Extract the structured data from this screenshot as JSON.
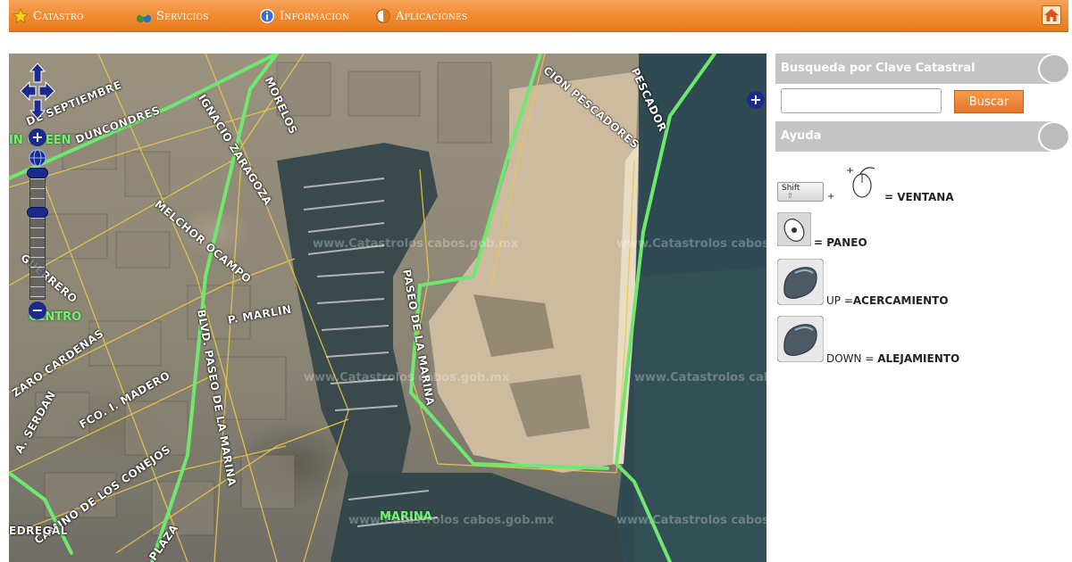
{
  "nav": {
    "items": [
      {
        "label": "Catastro",
        "icon": "star-icon"
      },
      {
        "label": "Servicios",
        "icon": "services-icon"
      },
      {
        "label": "Informacion",
        "icon": "info-icon"
      },
      {
        "label": "Aplicaciones",
        "icon": "apps-icon"
      }
    ],
    "home_icon": "home-icon",
    "bar_color": "#ef8a2f"
  },
  "map": {
    "streets": [
      "DE SEPTIEMBRE",
      "DUNCONDRES",
      "IGNACIO ZARAGOZA",
      "MORELOS",
      "MELCHOR OCAMPO",
      "GUERRERO",
      "P. MARLIN",
      "BLVD. PASEO DE LA MARINA",
      "PASEO DE LA MARINA",
      "ZARO CARDENAS",
      "FCO. I. MADERO",
      "A. SERDAN",
      "CAMINO DE LOS CONEJOS",
      "PLAZA",
      "CION PESCADORES",
      "PESCADOR",
      "EDREGAL"
    ],
    "zones": [
      "IN GREEN",
      "CENTRO",
      "MARINA"
    ],
    "watermark": "www.Catastrolos cabos.gob.mx",
    "boundary_color": "#6ee86e",
    "controls": {
      "zoom_in": "+",
      "zoom_out": "−",
      "layer_switcher": "+"
    }
  },
  "panel": {
    "busqueda": {
      "title": "Busqueda por Clave Catastral",
      "input_value": "",
      "input_placeholder": "",
      "button_label": "Buscar"
    },
    "ayuda": {
      "title": "Ayuda",
      "items": [
        {
          "key_label": "Shift",
          "plus": "+",
          "eq": "= VENTANA"
        },
        {
          "eq": "= PANEO"
        },
        {
          "prefix": "UP =",
          "bold": "ACERCAMIENTO"
        },
        {
          "prefix": "DOWN =",
          "bold": "ALEJAMIENTO"
        }
      ]
    },
    "accent_color": "#e5762b",
    "header_color": "#c4c4c4"
  }
}
